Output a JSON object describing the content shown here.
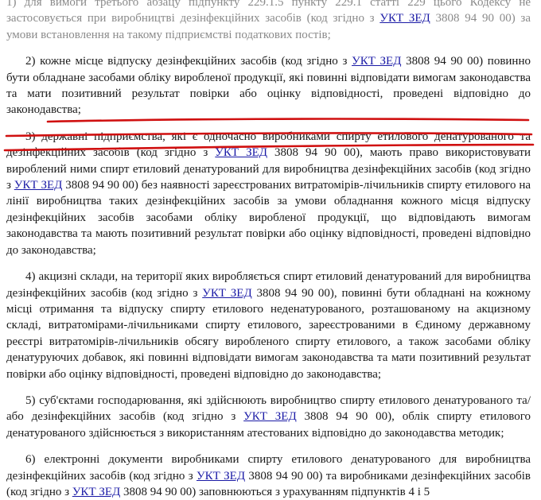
{
  "paragraphs": [
    {
      "id": "p1",
      "parts": [
        {
          "t": "1) для вимоги третього абзацу підпункту 229.1.5 пункту 229.1 статті 229 цього Кодексу не застосовується при виробництві дезінфекційних засобів (код згідно з "
        },
        {
          "t": "УКТ ЗЕД",
          "link": true
        },
        {
          "t": " 3808 94 90 00) за умови встановлення на такому підприємстві податкових постів;"
        }
      ]
    },
    {
      "id": "p2",
      "parts": [
        {
          "t": "2) кожне місце відпуску дезінфекційних засобів (код згідно з "
        },
        {
          "t": "УКТ ЗЕД",
          "link": true
        },
        {
          "t": " 3808 94 90 00) повинно бути обладнане засобами обліку виробленої продукції, які повинні відповідати вимогам законодавства та мати позитивний результат повірки або оцінку відповідності, проведені відповідно до законодавства;"
        }
      ]
    },
    {
      "id": "p3",
      "parts": [
        {
          "t": "3) державні підприємства, які є одночасно виробниками спирту етилового денатурованого та дезінфекційних засобів (код згідно з "
        },
        {
          "t": "УКТ ЗЕД",
          "link": true
        },
        {
          "t": " 3808 94 90 00), мають право використовувати вироблений ними спирт етиловий денатурований для виробництва дезінфекційних засобів (код згідно з "
        },
        {
          "t": "УКТ ЗЕД",
          "link": true
        },
        {
          "t": " 3808 94 90 00) без наявності зареєстрованих витратомірів-лічильників спирту етилового на лінії виробництва таких дезінфекційних засобів за умови обладнання кожного місця відпуску дезінфекційних засобів засобами обліку виробленої продукції, що відповідають вимогам законодавства та мають позитивний результат повірки або оцінку відповідності, проведені відповідно до законодавства;"
        }
      ]
    },
    {
      "id": "p4",
      "parts": [
        {
          "t": "4) акцизні склади, на території яких виробляється спирт етиловий денатурований для виробництва дезінфекційних засобів (код згідно з "
        },
        {
          "t": "УКТ ЗЕД",
          "link": true
        },
        {
          "t": " 3808 94 90 00), повинні бути обладнані на кожному місці отримання та відпуску спирту етилового неденатурованого, розташованому на акцизному складі, витратомірами-лічильниками спирту етилового, зареєстрованими в Єдиному державному реєстрі витратомірів-лічильників обсягу виробленого спирту етилового, а також засобами обліку денатуруючих добавок, які повинні відповідати вимогам законодавства та мати позитивний результат повірки або оцінку відповідності, проведені відповідно до законодавства;"
        }
      ]
    },
    {
      "id": "p5",
      "parts": [
        {
          "t": "5) суб'єктами господарювання, які здійснюють виробництво спирту етилового денатурованого та/або дезінфекційних засобів (код згідно з "
        },
        {
          "t": "УКТ ЗЕД",
          "link": true
        },
        {
          "t": " 3808 94 90 00), облік спирту етилового денатурованого здійснюється з використанням атестованих відповідно до законодавства методик;"
        }
      ]
    },
    {
      "id": "p6",
      "parts": [
        {
          "t": "6) електронні документи виробниками спирту етилового денатурованого для виробництва дезінфекційних засобів (код згідно з "
        },
        {
          "t": "УКТ ЗЕД",
          "link": true
        },
        {
          "t": " 3808 94 90 00) та виробниками дезінфекційних засобів (код згідно з "
        },
        {
          "t": "УКТ ЗЕД",
          "link": true
        },
        {
          "t": " 3808 94 90 00) заповнюються з урахуванням підпунктів 4 і 5"
        }
      ]
    }
  ]
}
